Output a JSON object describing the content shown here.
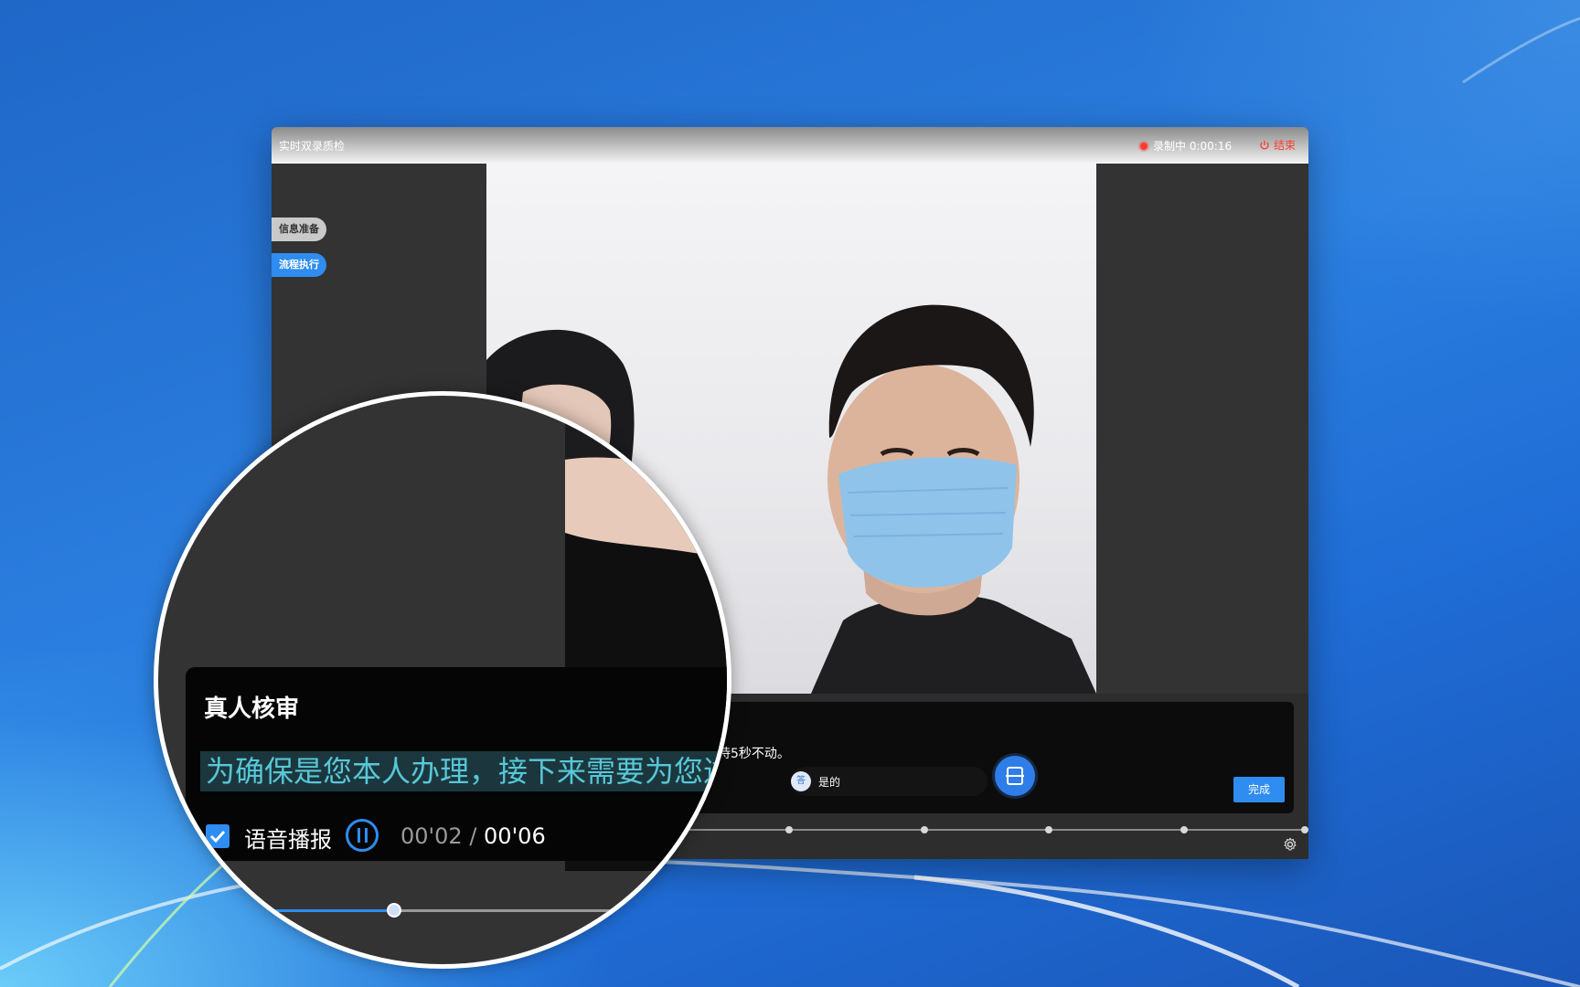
{
  "window": {
    "title": "实时双录质检",
    "recording_status": "录制中 0:00:16",
    "end_label": "结束"
  },
  "steps": [
    {
      "label": "信息准备",
      "active": false
    },
    {
      "label": "流程执行",
      "active": true
    }
  ],
  "script_panel": {
    "visible_text": "持5秒不动。",
    "answer_label": "是的",
    "answer_icon": "答",
    "done_label": "完成"
  },
  "magnifier": {
    "heading": "真人核审",
    "script_text": "为确保是您本人办理，接下来需要为您进",
    "voice_label": "语音播报",
    "voice_checked": true,
    "time_current": "00'02",
    "time_separator": " / ",
    "time_total": "00'06",
    "progress_fraction": 0.33
  },
  "colors": {
    "accent": "#2f8cf0",
    "record_red": "#ff3b30",
    "highlight_text": "#58c7d8"
  },
  "icons": {
    "record": "record-dot-icon",
    "end": "power-icon",
    "scan": "scan-icon",
    "settings": "gear-icon",
    "pause": "pause-icon",
    "check": "check-icon"
  }
}
